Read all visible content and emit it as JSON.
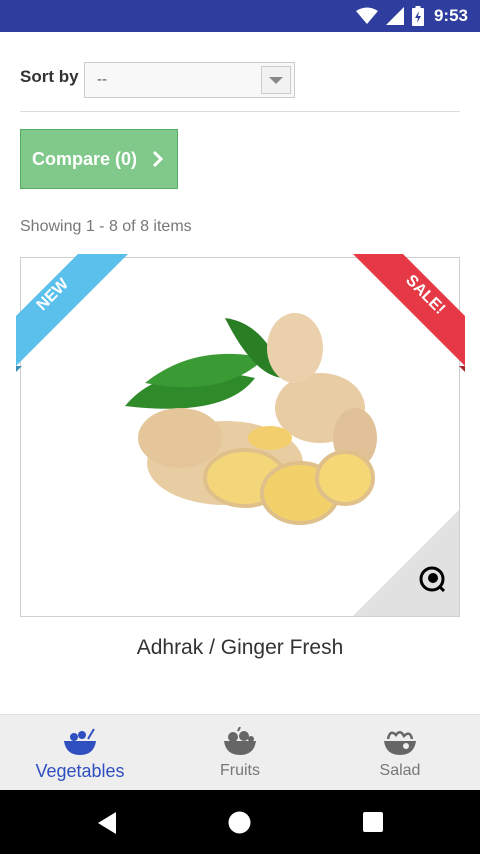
{
  "status_bar": {
    "time": "9:53"
  },
  "sort": {
    "label": "Sort by",
    "selected": "--"
  },
  "compare_button": {
    "label": "Compare (0)"
  },
  "showing_text": "Showing 1 - 8 of 8 items",
  "product": {
    "name": "Adhrak / Ginger Fresh",
    "ribbon_new": "NEW",
    "ribbon_sale": "SALE!"
  },
  "bottom_nav": [
    {
      "label": "Vegetables",
      "icon": "vegetables-bowl-icon",
      "active": true
    },
    {
      "label": "Fruits",
      "icon": "fruits-bowl-icon",
      "active": false
    },
    {
      "label": "Salad",
      "icon": "salad-bowl-icon",
      "active": false
    }
  ],
  "colors": {
    "status_bar": "#2f3d9e",
    "compare_button": "#80c98a",
    "ribbon_new": "#5bc0eb",
    "ribbon_sale": "#e53945",
    "nav_active": "#2f4fc0"
  }
}
